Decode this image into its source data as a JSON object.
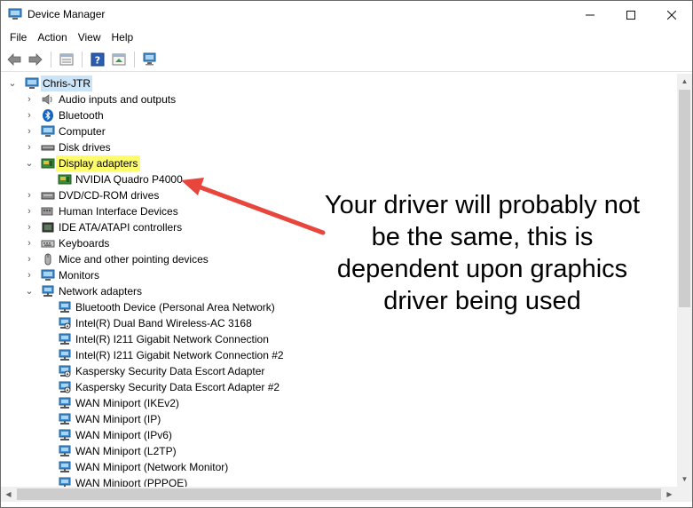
{
  "window": {
    "title": "Device Manager",
    "controls": {
      "minimize": "—",
      "maximize": "☐",
      "close": "✕"
    }
  },
  "menu": [
    "File",
    "Action",
    "View",
    "Help"
  ],
  "tree": {
    "root": "Chris-JTR",
    "categories": [
      "Audio inputs and outputs",
      "Bluetooth",
      "Computer",
      "Disk drives",
      "Display adapters",
      "DVD/CD-ROM drives",
      "Human Interface Devices",
      "IDE ATA/ATAPI controllers",
      "Keyboards",
      "Mice and other pointing devices",
      "Monitors",
      "Network adapters"
    ],
    "display_adapter_child": "NVIDIA Quadro P4000",
    "network_children": [
      "Bluetooth Device (Personal Area Network)",
      "Intel(R) Dual Band Wireless-AC 3168",
      "Intel(R) I211 Gigabit Network Connection",
      "Intel(R) I211 Gigabit Network Connection #2",
      "Kaspersky Security Data Escort Adapter",
      "Kaspersky Security Data Escort Adapter #2",
      "WAN Miniport (IKEv2)",
      "WAN Miniport (IP)",
      "WAN Miniport (IPv6)",
      "WAN Miniport (L2TP)",
      "WAN Miniport (Network Monitor)",
      "WAN Miniport (PPPOE)"
    ]
  },
  "annotation": {
    "lines": [
      "Your driver will probably not",
      "be the same, this is",
      "dependent upon graphics",
      "driver being used"
    ],
    "arrow_color": "#e8453c"
  },
  "colors": {
    "highlight": "#fffd6a",
    "monitor_blue": "#3d8fd6",
    "gpu_green": "#3a8a3a"
  }
}
